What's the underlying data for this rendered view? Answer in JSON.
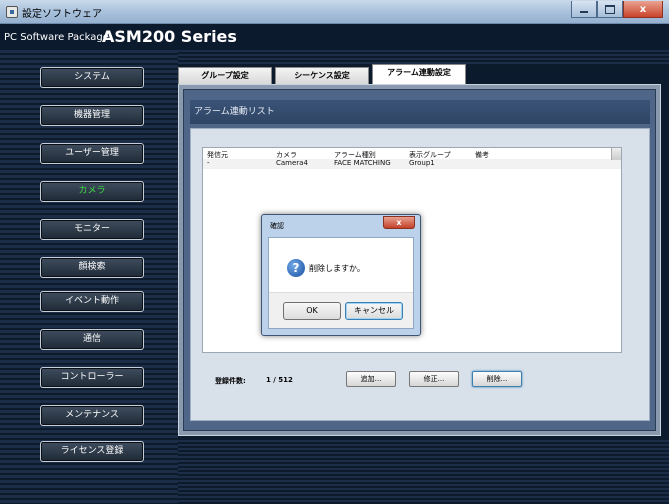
{
  "window": {
    "title": "設定ソフトウェア",
    "minimize": "",
    "maximize": "",
    "close": "x"
  },
  "product": {
    "prefix": "PC Software Package",
    "model": "ASM200 Series"
  },
  "sidebar": {
    "active_color": "#3ddc3d",
    "items": [
      {
        "label": "システム"
      },
      {
        "label": "機器管理"
      },
      {
        "label": "ユーザー管理"
      },
      {
        "label": "カメラ"
      },
      {
        "label": "モニター"
      },
      {
        "label": "顔検索"
      },
      {
        "label": "イベント動作"
      },
      {
        "label": "通信"
      },
      {
        "label": "コントローラー"
      },
      {
        "label": "メンテナンス"
      },
      {
        "label": "ライセンス登録"
      }
    ]
  },
  "tabs": [
    {
      "label": "グループ設定"
    },
    {
      "label": "シーケンス設定"
    },
    {
      "label": "アラーム連動設定"
    }
  ],
  "panel": {
    "title": "アラーム連動リスト"
  },
  "table": {
    "columns": [
      "発信元",
      "カメラ",
      "アラーム種別",
      "表示グループ",
      "備考"
    ],
    "rows": [
      [
        "-",
        "Camera4",
        "FACE MATCHING",
        "Group1",
        ""
      ]
    ]
  },
  "footer": {
    "count_label": "登録件数:",
    "count_value": "1 /   512",
    "add_label": "追加...",
    "edit_label": "修正...",
    "delete_label": "削除..."
  },
  "dialog": {
    "title": "確認",
    "close": "x",
    "icon": "?",
    "message": "削除しますか。",
    "ok_label": "OK",
    "cancel_label": "キャンセル"
  }
}
